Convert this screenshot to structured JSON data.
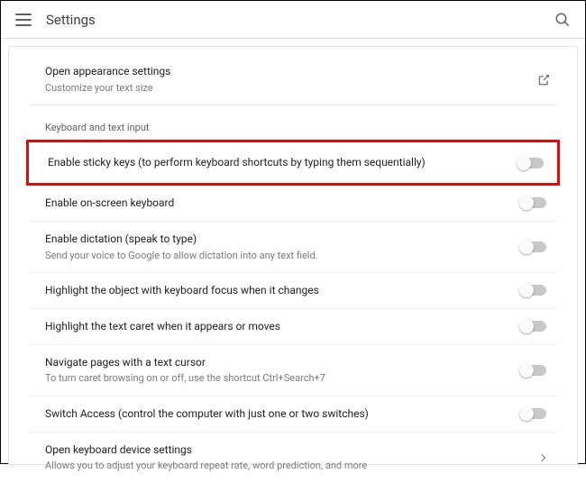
{
  "header": {
    "title": "Settings"
  },
  "appearance": {
    "title": "Open appearance settings",
    "desc": "Customize your text size"
  },
  "sectionLabel": "Keyboard and text input",
  "rows": {
    "sticky": {
      "title": "Enable sticky keys (to perform keyboard shortcuts by typing them sequentially)"
    },
    "onscreen": {
      "title": "Enable on-screen keyboard"
    },
    "dictation": {
      "title": "Enable dictation (speak to type)",
      "desc": "Send your voice to Google to allow dictation into any text field."
    },
    "focus": {
      "title": "Highlight the object with keyboard focus when it changes"
    },
    "caret": {
      "title": "Highlight the text caret when it appears or moves"
    },
    "navigate": {
      "title": "Navigate pages with a text cursor",
      "desc": "To turn caret browsing on or off, use the shortcut Ctrl+Search+7"
    },
    "switch": {
      "title": "Switch Access (control the computer with just one or two switches)"
    },
    "device": {
      "title": "Open keyboard device settings",
      "desc": "Allows you to adjust your keyboard repeat rate, word prediction, and more"
    }
  }
}
